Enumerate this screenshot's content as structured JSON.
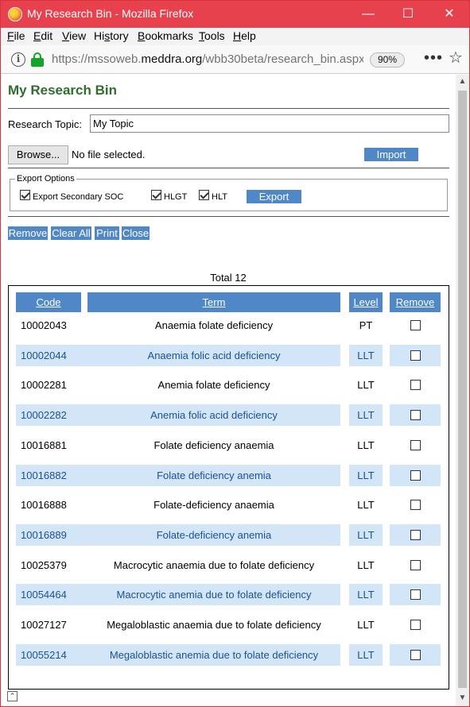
{
  "window": {
    "title": "My Research Bin - Mozilla Firefox",
    "min_glyph": "—",
    "max_glyph": "☐",
    "close_glyph": "✕"
  },
  "menu": [
    "File",
    "Edit",
    "View",
    "History",
    "Bookmarks",
    "Tools",
    "Help"
  ],
  "menu_accel": [
    "F",
    "E",
    "V",
    "s",
    "B",
    "T",
    "H"
  ],
  "address_bar": {
    "url_prefix": "https://mssoweb.",
    "url_host": "meddra.org",
    "url_path": "/wbb30beta/research_bin.aspx",
    "zoom": "90%"
  },
  "page": {
    "heading": "My Research Bin",
    "research_topic_label": "Research Topic:",
    "research_topic_value": "My Topic",
    "browse_label": "Browse...",
    "file_status": "No file selected.",
    "import_label": "Import",
    "export_options_legend": "Export Options",
    "export_options": [
      {
        "label": "Export Secondary SOC",
        "checked": true
      },
      {
        "label": "HLGT",
        "checked": true
      },
      {
        "label": "HLT",
        "checked": true
      }
    ],
    "export_label": "Export",
    "actions": [
      "Remove",
      "Clear All",
      "Print",
      "Close"
    ],
    "total_text": "Total 12"
  },
  "table": {
    "headers": [
      "Code",
      "Term",
      "Level",
      "Remove"
    ],
    "rows": [
      {
        "code": "10002043",
        "term": "Anaemia folate deficiency",
        "level": "PT"
      },
      {
        "code": "10002044",
        "term": "Anaemia folic acid deficiency",
        "level": "LLT"
      },
      {
        "code": "10002281",
        "term": "Anemia folate deficiency",
        "level": "LLT"
      },
      {
        "code": "10002282",
        "term": "Anemia folic acid deficiency",
        "level": "LLT"
      },
      {
        "code": "10016881",
        "term": "Folate deficiency anaemia",
        "level": "LLT"
      },
      {
        "code": "10016882",
        "term": "Folate deficiency anemia",
        "level": "LLT"
      },
      {
        "code": "10016888",
        "term": "Folate-deficiency anaemia",
        "level": "LLT"
      },
      {
        "code": "10016889",
        "term": "Folate-deficiency anemia",
        "level": "LLT"
      },
      {
        "code": "10025379",
        "term": "Macrocytic anaemia due to folate deficiency",
        "level": "LLT"
      },
      {
        "code": "10054464",
        "term": "Macrocytic anemia due to folate deficiency",
        "level": "LLT"
      },
      {
        "code": "10027127",
        "term": "Megaloblastic anaemia due to folate deficiency",
        "level": "LLT"
      },
      {
        "code": "10055214",
        "term": "Megaloblastic anemia due to folate deficiency",
        "level": "LLT"
      }
    ]
  },
  "colors": {
    "titlebar": "#e8414e",
    "heading": "#2e6f2e",
    "button": "#4f87c7",
    "alt_row": "#d3e6f8"
  }
}
